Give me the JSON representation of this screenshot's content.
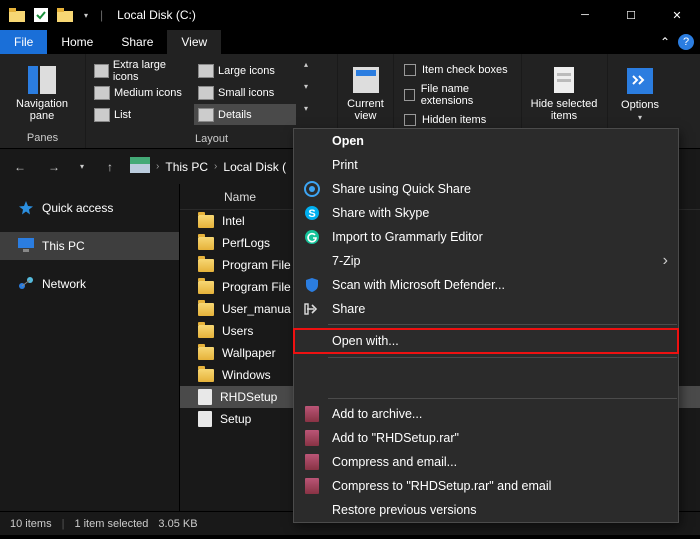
{
  "window": {
    "title": "Local Disk (C:)"
  },
  "tabs": {
    "file": "File",
    "home": "Home",
    "share": "Share",
    "view": "View"
  },
  "ribbon": {
    "nav_pane": "Navigation\npane",
    "panes_label": "Panes",
    "layout_label": "Layout",
    "layout": {
      "xl_icons": "Extra large icons",
      "lg_icons": "Large icons",
      "md_icons": "Medium icons",
      "sm_icons": "Small icons",
      "list": "List",
      "details": "Details"
    },
    "current_view": "Current\nview",
    "checks": {
      "item_boxes": "Item check boxes",
      "ext": "File name extensions",
      "hidden": "Hidden items"
    },
    "hide_selected": "Hide selected\nitems",
    "options": "Options"
  },
  "breadcrumb": {
    "root": "This PC",
    "loc": "Local Disk ("
  },
  "sidebar": {
    "quick": "Quick access",
    "thispc": "This PC",
    "network": "Network"
  },
  "columns": {
    "name": "Name"
  },
  "files": [
    {
      "name": "Intel",
      "type": "folder"
    },
    {
      "name": "PerfLogs",
      "type": "folder"
    },
    {
      "name": "Program File",
      "type": "folder"
    },
    {
      "name": "Program File",
      "type": "folder"
    },
    {
      "name": "User_manua",
      "type": "folder"
    },
    {
      "name": "Users",
      "type": "folder"
    },
    {
      "name": "Wallpaper",
      "type": "folder"
    },
    {
      "name": "Windows",
      "type": "folder"
    },
    {
      "name": "RHDSetup",
      "type": "file",
      "selected": true
    },
    {
      "name": "Setup",
      "type": "file"
    }
  ],
  "status": {
    "count": "10 items",
    "selected": "1 item selected",
    "size": "3.05 KB"
  },
  "context_menu": {
    "open": "Open",
    "print": "Print",
    "quick_share": "Share using Quick Share",
    "skype": "Share with Skype",
    "grammarly": "Import to Grammarly Editor",
    "sevenzip": "7-Zip",
    "defender": "Scan with Microsoft Defender...",
    "share": "Share",
    "open_with": "Open with...",
    "add_archive": "Add to archive...",
    "add_rar": "Add to \"RHDSetup.rar\"",
    "compress_email": "Compress and email...",
    "compress_rar_email": "Compress to \"RHDSetup.rar\" and email",
    "restore": "Restore previous versions"
  }
}
